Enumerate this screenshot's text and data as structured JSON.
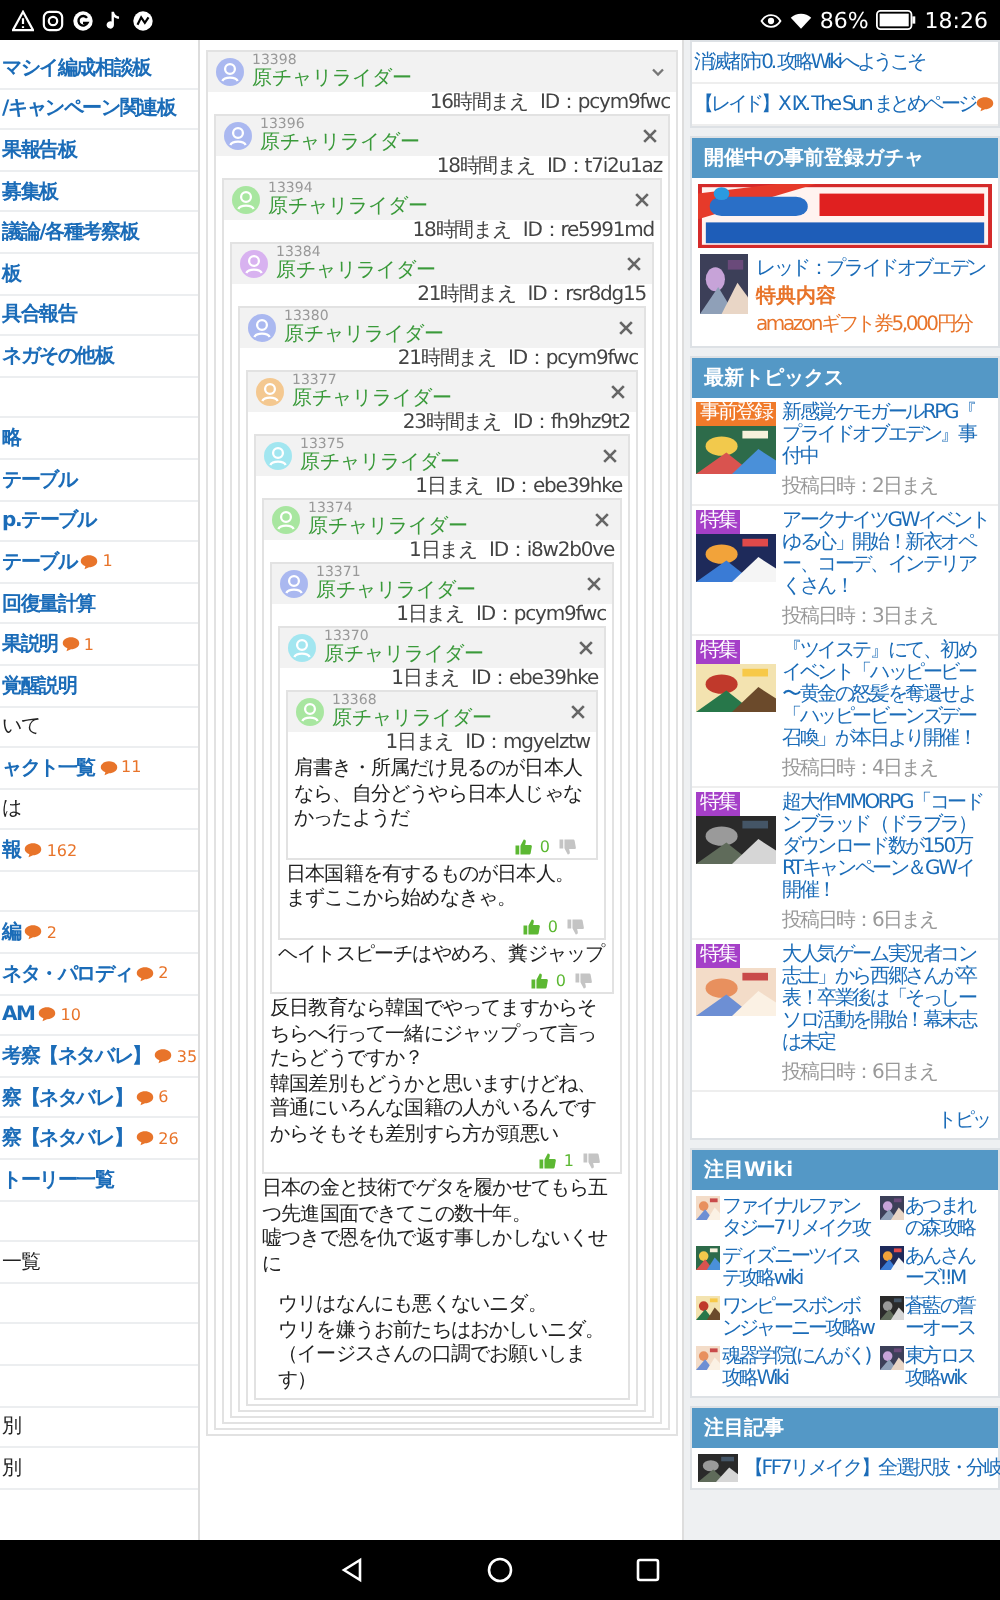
{
  "status_bar": {
    "battery": "86%",
    "time": "18:26"
  },
  "sidebar": {
    "items": [
      {
        "kind": "link",
        "label": "マシイ編成相談板"
      },
      {
        "kind": "link",
        "label": "/キャンペーン関連板"
      },
      {
        "kind": "link",
        "label": "果報告板"
      },
      {
        "kind": "link",
        "label": "募集板"
      },
      {
        "kind": "link",
        "label": "議論/各種考察板"
      },
      {
        "kind": "link",
        "label": "板"
      },
      {
        "kind": "link",
        "label": "具合報告"
      },
      {
        "kind": "link",
        "label": "ネガその他板"
      },
      {
        "kind": "blank"
      },
      {
        "kind": "link",
        "label": "略"
      },
      {
        "kind": "link",
        "label": "テーブル"
      },
      {
        "kind": "link",
        "label": "p.テーブル"
      },
      {
        "kind": "link",
        "label": "テーブル",
        "count": "1"
      },
      {
        "kind": "link",
        "label": "回復量計算"
      },
      {
        "kind": "link",
        "label": "果説明",
        "count": "1"
      },
      {
        "kind": "link",
        "label": "覚醒説明"
      },
      {
        "kind": "plain",
        "label": "いて"
      },
      {
        "kind": "link",
        "label": "ャクト一覧",
        "count": "11"
      },
      {
        "kind": "plain",
        "label": "は"
      },
      {
        "kind": "link",
        "label": "報",
        "count": "162"
      },
      {
        "kind": "blank"
      },
      {
        "kind": "link",
        "label": "編",
        "count": "2"
      },
      {
        "kind": "link",
        "label": "ネタ・パロディ",
        "count": "2"
      },
      {
        "kind": "link",
        "label": "AM",
        "count": "10"
      },
      {
        "kind": "link",
        "label": "考察【ネタバレ】",
        "count": "35"
      },
      {
        "kind": "link",
        "label": "察【ネタバレ】",
        "count": "6"
      },
      {
        "kind": "link",
        "label": "察【ネタバレ】",
        "count": "26"
      },
      {
        "kind": "link",
        "label": "トーリー一覧"
      },
      {
        "kind": "blank"
      },
      {
        "kind": "plain",
        "label": "一覧"
      },
      {
        "kind": "blank"
      },
      {
        "kind": "blank"
      },
      {
        "kind": "blank"
      },
      {
        "kind": "plain",
        "label": "別"
      },
      {
        "kind": "plain",
        "label": "別"
      }
    ]
  },
  "thread": {
    "kind": "collapsible",
    "number": "13398",
    "name": "原チャリライダー",
    "color": "#aab8f0",
    "time": "16時間まえ",
    "user_id": "ID：pcym9fwc",
    "children": [
      {
        "kind": "closable",
        "number": "13396",
        "name": "原チャリライダー",
        "color": "#aab8f0",
        "time": "18時間まえ",
        "user_id": "ID：t7i2u1az",
        "children": [
          {
            "kind": "closable",
            "number": "13394",
            "name": "原チャリライダー",
            "color": "#a8e6a0",
            "time": "18時間まえ",
            "user_id": "ID：re5991md",
            "children": [
              {
                "kind": "closable",
                "number": "13384",
                "name": "原チャリライダー",
                "color": "#d8b2f0",
                "time": "21時間まえ",
                "user_id": "ID：rsr8dg15",
                "children": [
                  {
                    "kind": "closable",
                    "number": "13380",
                    "name": "原チャリライダー",
                    "color": "#aab8f0",
                    "time": "21時間まえ",
                    "user_id": "ID：pcym9fwc",
                    "children": [
                      {
                        "kind": "closable",
                        "number": "13377",
                        "name": "原チャリライダー",
                        "color": "#f4c890",
                        "time": "23時間まえ",
                        "user_id": "ID：fh9hz9t2",
                        "children": [
                          {
                            "kind": "closable",
                            "number": "13375",
                            "name": "原チャリライダー",
                            "color": "#a2e6f0",
                            "time": "1日まえ",
                            "user_id": "ID：ebe39hke",
                            "body": [
                              "日本の金と技術でゲタを履かせてもら五つ先進国面できてこの数十年。",
                              "嘘つきで恩を仇で返す事しかしないくせに"
                            ],
                            "quote": [
                              "ウリはなんにも悪くないニダ。",
                              "ウリを嫌うお前たちはおかしいニダ。",
                              "（イージスさんの口調でお願いします）"
                            ],
                            "children": [
                              {
                                "kind": "closable",
                                "number": "13374",
                                "name": "原チャリライダー",
                                "color": "#a8e6a0",
                                "time": "1日まえ",
                                "user_id": "ID：i8w2b0ve",
                                "body": [
                                  "反日教育なら韓国でやってますからそちらへ行って一緒にジャップって言ったらどうですか？",
                                  "韓国差別もどうかと思いますけどね、普通にいろんな国籍の人がいるんですからそもそも差別すら方が頭悪い"
                                ],
                                "likes": "1",
                                "children": [
                                  {
                                    "kind": "closable",
                                    "number": "13371",
                                    "name": "原チャリライダー",
                                    "color": "#aab8f0",
                                    "time": "1日まえ",
                                    "user_id": "ID：pcym9fwc",
                                    "body": [
                                      "ヘイトスピーチはやめろ、糞ジャップ"
                                    ],
                                    "likes": "0",
                                    "children": [
                                      {
                                        "kind": "closable",
                                        "number": "13370",
                                        "name": "原チャリライダー",
                                        "color": "#a2e6f0",
                                        "time": "1日まえ",
                                        "user_id": "ID：ebe39hke",
                                        "body": [
                                          "日本国籍を有するものが日本人。",
                                          "まずここから始めなきゃ。"
                                        ],
                                        "likes": "0",
                                        "children": [
                                          {
                                            "kind": "closable",
                                            "number": "13368",
                                            "name": "原チャリライダー",
                                            "color": "#a8e6a0",
                                            "time": "1日まえ",
                                            "user_id": "ID：mgyelztw",
                                            "body": [
                                              "肩書き・所属だけ見るのが日本人なら、自分どうやら日本人じゃなかったようだ"
                                            ],
                                            "likes": "0"
                                          }
                                        ]
                                      }
                                    ]
                                  }
                                ]
                              }
                            ]
                          }
                        ]
                      }
                    ]
                  }
                ]
              }
            ]
          }
        ]
      }
    ]
  },
  "right": {
    "links": [
      {
        "label": "消滅都市0. 攻略Wikiへようこそ",
        "has_comments": false
      },
      {
        "label": "【レイド】X IX. The Sun まとめページ",
        "has_comments": true
      }
    ],
    "gacha": {
      "title": "開催中の事前登録ガチャ",
      "game": "レッド：プライドオブエデン",
      "perk_label": "特典内容",
      "perk": "amazonギフト券5,000円分"
    },
    "topics": {
      "title": "最新トピックス",
      "more": "トピッ",
      "items": [
        {
          "badge": {
            "text": "事前登録",
            "color": "#f07a2a"
          },
          "lines": [
            "新感覚ケモガールRPG『",
            "プライドオブエデン』事",
            "付中"
          ],
          "date": "投稿日時：2日まえ"
        },
        {
          "badge": {
            "text": "特集",
            "color": "#a53fc8"
          },
          "lines": [
            "アークナイツGWイベント",
            "ゆる心」開始！新衣オペ",
            "ー、コーデ、インテリア",
            "くさん！"
          ],
          "date": "投稿日時：3日まえ"
        },
        {
          "badge": {
            "text": "特集",
            "color": "#a53fc8"
          },
          "lines": [
            "『ツイステ』にて、初め",
            "イベント「ハッピービー",
            "〜黄金の怒髪を奪還せよ",
            "「ハッピービーンズデー",
            "召喚」が本日より開催！"
          ],
          "date": "投稿日時：4日まえ"
        },
        {
          "badge": {
            "text": "特集",
            "color": "#a53fc8"
          },
          "lines": [
            "超大作MMORPG「コード",
            "ンブラッド（ドラブラ）",
            "ダウンロード数が150万",
            "RTキャンペーン＆GWイ",
            "開催！"
          ],
          "date": "投稿日時：6日まえ"
        },
        {
          "badge": {
            "text": "特集",
            "color": "#a53fc8"
          },
          "lines": [
            "大人気ゲーム実況者コン",
            "志士」から西郷さんが卒",
            "表！卒業後は「そっしー",
            "ソロ活動を開始！幕末志",
            "は未定"
          ],
          "date": "投稿日時：6日まえ"
        }
      ]
    },
    "wiki": {
      "title": "注目Wiki",
      "items": [
        {
          "lines": [
            "ファイナルファン",
            "タジー7リメイク攻"
          ]
        },
        {
          "lines": [
            "あつまれ",
            "の森攻略"
          ]
        },
        {
          "lines": [
            "ディズニーツイス",
            "テ攻略wiki"
          ]
        },
        {
          "lines": [
            "あんさん",
            "ーズ!!M"
          ]
        },
        {
          "lines": [
            "ワンピースボンボ",
            "ンジャーニー攻略w"
          ]
        },
        {
          "lines": [
            "蒼藍の誓",
            "ーオース"
          ]
        },
        {
          "lines": [
            "魂器学院(にんがく)",
            "攻略Wiki"
          ]
        },
        {
          "lines": [
            "東方ロス",
            "攻略wik"
          ]
        }
      ]
    },
    "articles": {
      "title": "注目記事",
      "items": [
        {
          "label": "【FF7リメイク】全選択肢・分岐"
        }
      ]
    }
  }
}
